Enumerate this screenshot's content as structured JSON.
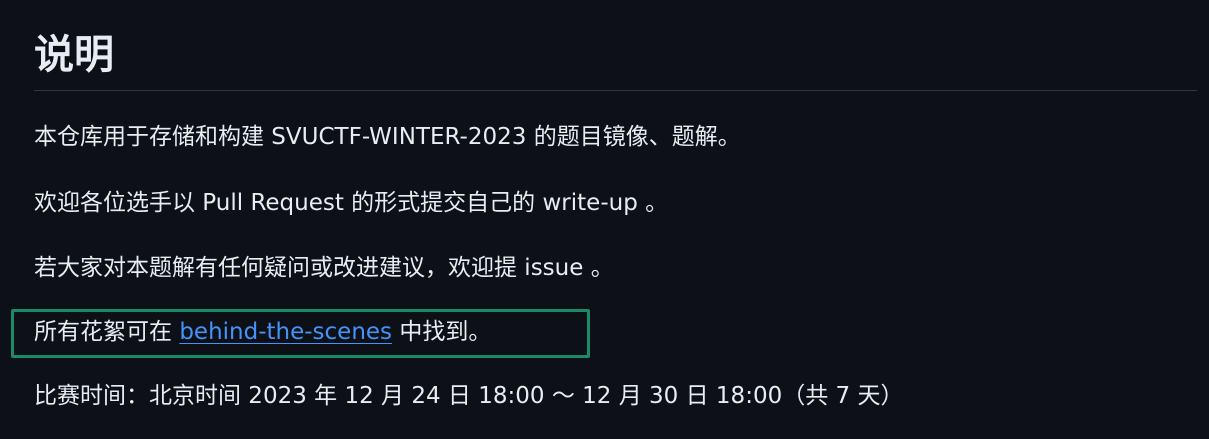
{
  "readme": {
    "heading": "说明",
    "paragraphs": {
      "p1": "本仓库用于存储和构建 SVUCTF-WINTER-2023 的题目镜像、题解。",
      "p2": "欢迎各位选手以 Pull Request 的形式提交自己的 write-up 。",
      "p3": "若大家对本题解有任何疑问或改进建议，欢迎提 issue 。",
      "p4_before": "所有花絮可在 ",
      "p4_link": "behind-the-scenes",
      "p4_after": " 中找到。",
      "p5": "比赛时间：北京时间 2023 年 12 月 24 日 18:00 ～ 12 月 30 日 18:00（共 7 天）"
    }
  },
  "colors": {
    "background": "#0d1117",
    "text": "#e6edf3",
    "link": "#4493f8",
    "highlight_border": "#1b8a68",
    "rule": "#30363d"
  }
}
